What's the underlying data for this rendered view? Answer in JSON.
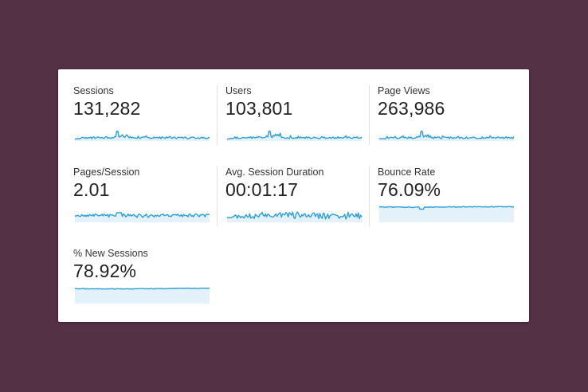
{
  "metrics": [
    {
      "id": "sessions",
      "label": "Sessions",
      "value": "131,282",
      "spark": "spiky-flat"
    },
    {
      "id": "users",
      "label": "Users",
      "value": "103,801",
      "spark": "spiky-flat"
    },
    {
      "id": "pageviews",
      "label": "Page Views",
      "value": "263,986",
      "spark": "spiky-flat"
    },
    {
      "id": "pages-session",
      "label": "Pages/Session",
      "value": "2.01",
      "spark": "noisy"
    },
    {
      "id": "avg-session-duration",
      "label": "Avg. Session Duration",
      "value": "00:01:17",
      "spark": "very-noisy"
    },
    {
      "id": "bounce-rate",
      "label": "Bounce Rate",
      "value": "76.09%",
      "spark": "high-flat"
    },
    {
      "id": "new-sessions",
      "label": "% New Sessions",
      "value": "78.92%",
      "spark": "high-flat-2"
    }
  ],
  "colors": {
    "line": "#2f9fd8",
    "fill": "#e2f1fa",
    "background": "#553145",
    "card": "#ffffff"
  }
}
